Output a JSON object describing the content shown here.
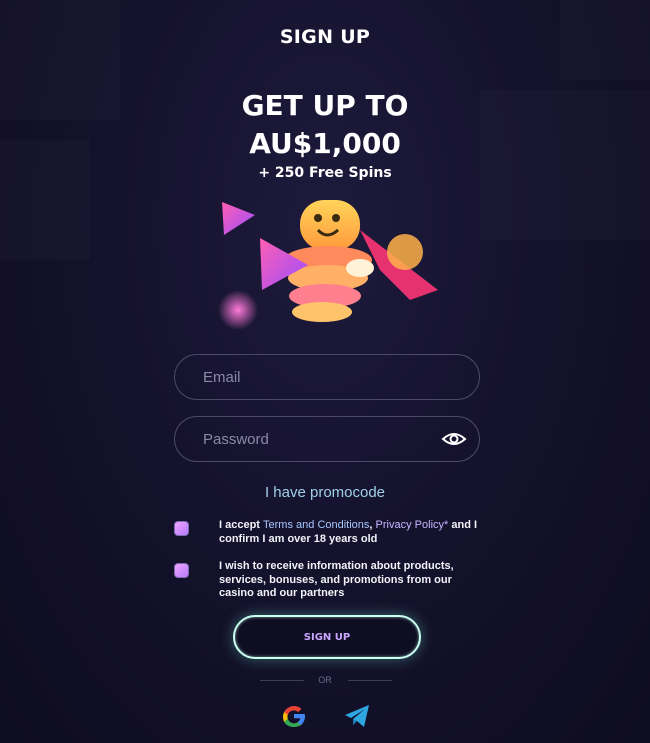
{
  "header": {
    "title": "SIGN UP"
  },
  "promo": {
    "line1": "GET UP TO",
    "line2": "AU$1,000",
    "subline": "+ 250 Free Spins"
  },
  "form": {
    "email_placeholder": "Email",
    "password_placeholder": "Password",
    "promocode_link": "I have promocode",
    "terms": {
      "prefix": "I accept ",
      "terms_link": "Terms and Conditions",
      "comma": ", ",
      "privacy_link": "Privacy Policy*",
      "suffix": " and I confirm I am over 18 years old",
      "checked": true
    },
    "marketing": {
      "text": "I wish to receive information about products, services, bonuses, and promotions from our casino and our partners",
      "checked": true
    },
    "submit_label": "SIGN UP"
  },
  "social": {
    "divider_text": "OR",
    "providers": [
      "google-icon",
      "telegram-icon"
    ]
  },
  "colors": {
    "background": "#15122d",
    "accent_link": "#9fd0ea",
    "button_glow": "#c9fff1",
    "button_text": "#c9a6ff"
  }
}
